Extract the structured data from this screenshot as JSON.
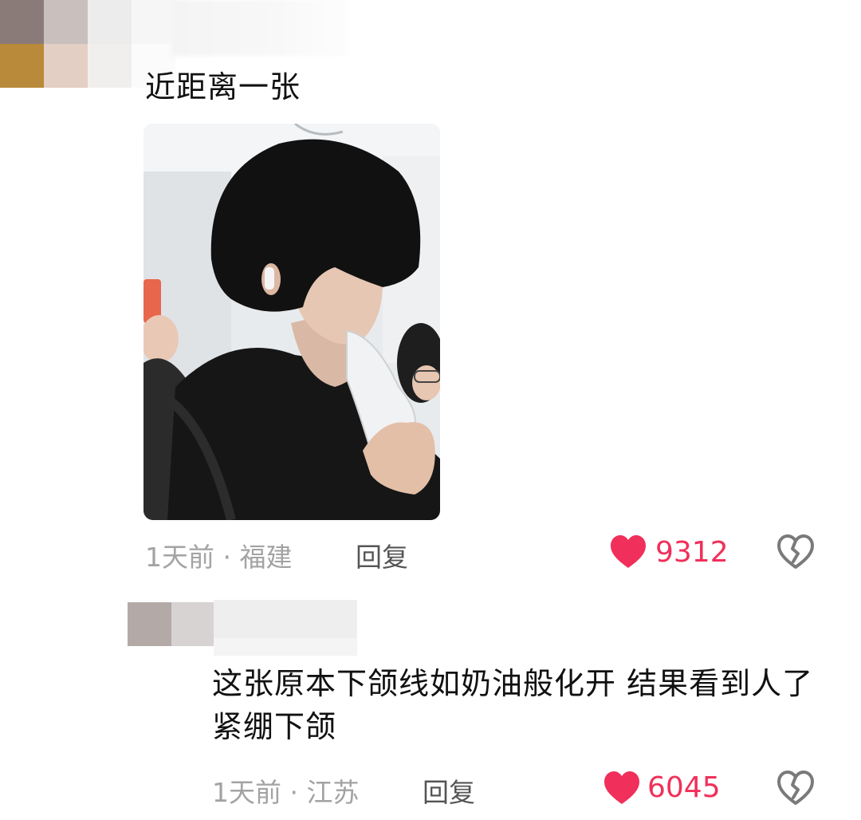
{
  "comments": [
    {
      "text": "近距离一张",
      "time": "1天前",
      "location": "福建",
      "meta": "1天前 · 福建",
      "reply_label": "回复",
      "likes": "9312"
    },
    {
      "text": "这张原本下颌线如奶油般化开 结果看到人了紧绷下颌",
      "time": "1天前",
      "location": "江苏",
      "meta": "1天前 · 江苏",
      "reply_label": "回复",
      "likes": "6045"
    }
  ],
  "icons": {
    "like": "heart-icon",
    "dislike": "broken-heart-icon"
  },
  "colors": {
    "like_red": "#f0305a",
    "meta_gray": "#a3a3a3",
    "text": "#111111"
  }
}
